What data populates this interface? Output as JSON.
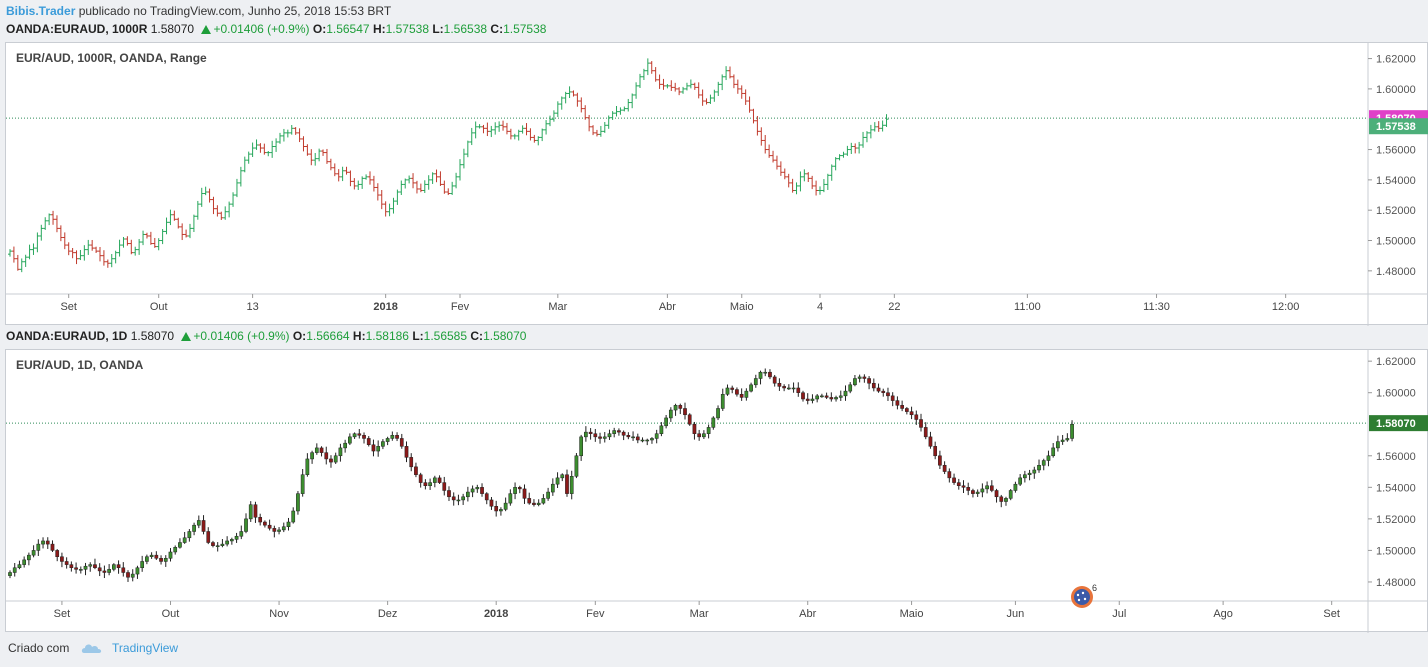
{
  "header": {
    "author": "Bibis.Trader",
    "text": "publicado no TradingView.com, Junho 25, 2018 15:53 BRT"
  },
  "top_symbol": {
    "name": "OANDA:EURAUD, 1000R",
    "price": "1.58070",
    "change": "+0.01406 (+0.9%)",
    "o_label": "O:",
    "o": "1.56547",
    "h_label": "H:",
    "h": "1.57538",
    "l_label": "L:",
    "l": "1.56538",
    "c_label": "C:",
    "c": "1.57538"
  },
  "bottom_symbol": {
    "name": "OANDA:EURAUD, 1D",
    "price": "1.58070",
    "change": "+0.01406 (+0.9%)",
    "o_label": "O:",
    "o": "1.56664",
    "h_label": "H:",
    "h": "1.58186",
    "l_label": "L:",
    "l": "1.56585",
    "c_label": "C:",
    "c": "1.58070"
  },
  "footer": {
    "created": "Criado com",
    "brand": "TradingView"
  },
  "colors": {
    "up": "#26a65b",
    "down": "#c0392b",
    "candle_up": "#3c8d2f",
    "candle_down": "#8b1a1a",
    "price_line": "#2e8b57",
    "tag_pink": "#e040c8",
    "tag_green": "#4caf7a",
    "tag_dark": "#2e7d32"
  },
  "badge": {
    "count": "6"
  },
  "chart_data": [
    {
      "type": "bar",
      "title": "EUR/AUD, 1000R, OANDA, Range",
      "ylim": [
        1.47,
        1.625
      ],
      "y_ticks": [
        "1.62000",
        "1.60000",
        "1.58070",
        "1.57538",
        "1.56000",
        "1.54000",
        "1.52000",
        "1.50000",
        "1.48000"
      ],
      "price_tags": [
        {
          "label": "1.58070",
          "value": 1.5807,
          "style": "pink"
        },
        {
          "label": "1.57538",
          "value": 1.57538,
          "style": "green"
        }
      ],
      "x_ticks": [
        {
          "label": "Set",
          "bold": false
        },
        {
          "label": "Out",
          "bold": false
        },
        {
          "label": "13",
          "bold": false
        },
        {
          "label": "2018",
          "bold": true
        },
        {
          "label": "Fev",
          "bold": false
        },
        {
          "label": "Mar",
          "bold": false
        },
        {
          "label": "Abr",
          "bold": false
        },
        {
          "label": "Maio",
          "bold": false
        },
        {
          "label": "4",
          "bold": false
        },
        {
          "label": "22",
          "bold": false
        },
        {
          "label": "11:00",
          "bold": false
        },
        {
          "label": "11:30",
          "bold": false
        },
        {
          "label": "12:00",
          "bold": false
        }
      ],
      "x_tick_index": [
        15,
        38,
        62,
        96,
        115,
        140,
        168,
        187,
        207,
        226,
        260,
        293,
        326
      ],
      "price_line": 1.5807,
      "closes": [
        1.493,
        1.488,
        1.481,
        1.486,
        1.489,
        1.494,
        1.495,
        1.503,
        1.508,
        1.513,
        1.517,
        1.514,
        1.508,
        1.502,
        1.497,
        1.493,
        1.492,
        1.488,
        1.49,
        1.494,
        1.497,
        1.495,
        1.493,
        1.49,
        1.486,
        1.485,
        1.488,
        1.492,
        1.497,
        1.501,
        1.498,
        1.492,
        1.494,
        1.499,
        1.504,
        1.503,
        1.498,
        1.496,
        1.5,
        1.506,
        1.512,
        1.517,
        1.514,
        1.509,
        1.504,
        1.503,
        1.508,
        1.516,
        1.524,
        1.531,
        1.532,
        1.527,
        1.521,
        1.518,
        1.515,
        1.519,
        1.524,
        1.53,
        1.538,
        1.546,
        1.553,
        1.557,
        1.561,
        1.563,
        1.561,
        1.558,
        1.558,
        1.562,
        1.565,
        1.569,
        1.571,
        1.571,
        1.574,
        1.571,
        1.567,
        1.562,
        1.557,
        1.553,
        1.554,
        1.559,
        1.558,
        1.552,
        1.548,
        1.544,
        1.542,
        1.546,
        1.545,
        1.539,
        1.536,
        1.537,
        1.541,
        1.542,
        1.54,
        1.535,
        1.53,
        1.524,
        1.519,
        1.521,
        1.526,
        1.532,
        1.537,
        1.54,
        1.541,
        1.538,
        1.534,
        1.533,
        1.537,
        1.54,
        1.544,
        1.542,
        1.537,
        1.532,
        1.531,
        1.536,
        1.542,
        1.55,
        1.557,
        1.565,
        1.571,
        1.575,
        1.575,
        1.574,
        1.572,
        1.573,
        1.575,
        1.576,
        1.575,
        1.572,
        1.569,
        1.569,
        1.572,
        1.574,
        1.572,
        1.568,
        1.566,
        1.568,
        1.573,
        1.577,
        1.58,
        1.584,
        1.59,
        1.594,
        1.597,
        1.598,
        1.596,
        1.592,
        1.587,
        1.581,
        1.575,
        1.571,
        1.57,
        1.572,
        1.576,
        1.581,
        1.584,
        1.585,
        1.586,
        1.587,
        1.591,
        1.596,
        1.602,
        1.608,
        1.612,
        1.617,
        1.612,
        1.606,
        1.603,
        1.602,
        1.602,
        1.601,
        1.6,
        1.598,
        1.6,
        1.602,
        1.603,
        1.601,
        1.596,
        1.592,
        1.591,
        1.594,
        1.598,
        1.603,
        1.608,
        1.612,
        1.608,
        1.603,
        1.6,
        1.597,
        1.592,
        1.586,
        1.579,
        1.572,
        1.566,
        1.56,
        1.556,
        1.553,
        1.549,
        1.545,
        1.542,
        1.538,
        1.533,
        1.536,
        1.542,
        1.544,
        1.541,
        1.536,
        1.533,
        1.533,
        1.537,
        1.543,
        1.549,
        1.554,
        1.556,
        1.557,
        1.56,
        1.562,
        1.561,
        1.563,
        1.568,
        1.571,
        1.573,
        1.575,
        1.574,
        1.576,
        1.58
      ]
    },
    {
      "type": "candlestick",
      "title": "EUR/AUD, 1D, OANDA",
      "ylim": [
        1.473,
        1.622
      ],
      "y_ticks": [
        "1.62000",
        "1.60000",
        "1.58070",
        "1.56000",
        "1.54000",
        "1.52000",
        "1.50000",
        "1.48000"
      ],
      "price_tags": [
        {
          "label": "1.58070",
          "value": 1.5807,
          "style": "dark"
        }
      ],
      "x_ticks": [
        {
          "label": "Set",
          "bold": false
        },
        {
          "label": "Out",
          "bold": false
        },
        {
          "label": "Nov",
          "bold": false
        },
        {
          "label": "Dez",
          "bold": false
        },
        {
          "label": "2018",
          "bold": true
        },
        {
          "label": "Fev",
          "bold": false
        },
        {
          "label": "Mar",
          "bold": false
        },
        {
          "label": "Abr",
          "bold": false
        },
        {
          "label": "Maio",
          "bold": false
        },
        {
          "label": "Jun",
          "bold": false
        },
        {
          "label": "Jul",
          "bold": false
        },
        {
          "label": "Ago",
          "bold": false
        },
        {
          "label": "Set",
          "bold": false
        }
      ],
      "x_tick_index": [
        11,
        34,
        57,
        80,
        103,
        124,
        146,
        169,
        191,
        213,
        235,
        257,
        280
      ],
      "price_line": 1.5807,
      "closes": [
        1.486,
        1.489,
        1.491,
        1.494,
        1.497,
        1.5,
        1.504,
        1.506,
        1.504,
        1.5,
        1.496,
        1.493,
        1.491,
        1.489,
        1.488,
        1.488,
        1.49,
        1.491,
        1.489,
        1.487,
        1.486,
        1.488,
        1.491,
        1.489,
        1.486,
        1.483,
        1.485,
        1.489,
        1.493,
        1.496,
        1.497,
        1.495,
        1.493,
        1.495,
        1.499,
        1.502,
        1.505,
        1.508,
        1.512,
        1.516,
        1.519,
        1.512,
        1.505,
        1.503,
        1.503,
        1.504,
        1.506,
        1.507,
        1.509,
        1.512,
        1.52,
        1.529,
        1.521,
        1.518,
        1.516,
        1.514,
        1.512,
        1.513,
        1.515,
        1.518,
        1.525,
        1.536,
        1.548,
        1.558,
        1.562,
        1.565,
        1.562,
        1.558,
        1.556,
        1.56,
        1.565,
        1.568,
        1.572,
        1.574,
        1.573,
        1.571,
        1.567,
        1.563,
        1.566,
        1.569,
        1.571,
        1.573,
        1.571,
        1.566,
        1.559,
        1.553,
        1.548,
        1.543,
        1.541,
        1.543,
        1.546,
        1.543,
        1.538,
        1.534,
        1.532,
        1.532,
        1.534,
        1.537,
        1.539,
        1.54,
        1.536,
        1.532,
        1.528,
        1.525,
        1.526,
        1.53,
        1.536,
        1.54,
        1.539,
        1.533,
        1.53,
        1.529,
        1.53,
        1.533,
        1.537,
        1.542,
        1.546,
        1.548,
        1.536,
        1.547,
        1.56,
        1.572,
        1.575,
        1.574,
        1.572,
        1.571,
        1.572,
        1.574,
        1.576,
        1.575,
        1.573,
        1.572,
        1.572,
        1.57,
        1.57,
        1.57,
        1.571,
        1.574,
        1.579,
        1.584,
        1.589,
        1.592,
        1.59,
        1.586,
        1.58,
        1.574,
        1.572,
        1.574,
        1.578,
        1.584,
        1.59,
        1.599,
        1.603,
        1.602,
        1.599,
        1.597,
        1.601,
        1.605,
        1.609,
        1.613,
        1.613,
        1.61,
        1.606,
        1.604,
        1.603,
        1.603,
        1.603,
        1.6,
        1.596,
        1.595,
        1.596,
        1.598,
        1.598,
        1.597,
        1.596,
        1.597,
        1.598,
        1.601,
        1.605,
        1.609,
        1.61,
        1.609,
        1.606,
        1.603,
        1.601,
        1.6,
        1.598,
        1.595,
        1.592,
        1.59,
        1.588,
        1.586,
        1.583,
        1.578,
        1.572,
        1.566,
        1.56,
        1.554,
        1.55,
        1.546,
        1.543,
        1.541,
        1.54,
        1.538,
        1.536,
        1.537,
        1.539,
        1.541,
        1.538,
        1.534,
        1.531,
        1.533,
        1.538,
        1.542,
        1.546,
        1.548,
        1.549,
        1.551,
        1.554,
        1.557,
        1.56,
        1.565,
        1.569,
        1.57,
        1.571,
        1.58
      ]
    }
  ]
}
